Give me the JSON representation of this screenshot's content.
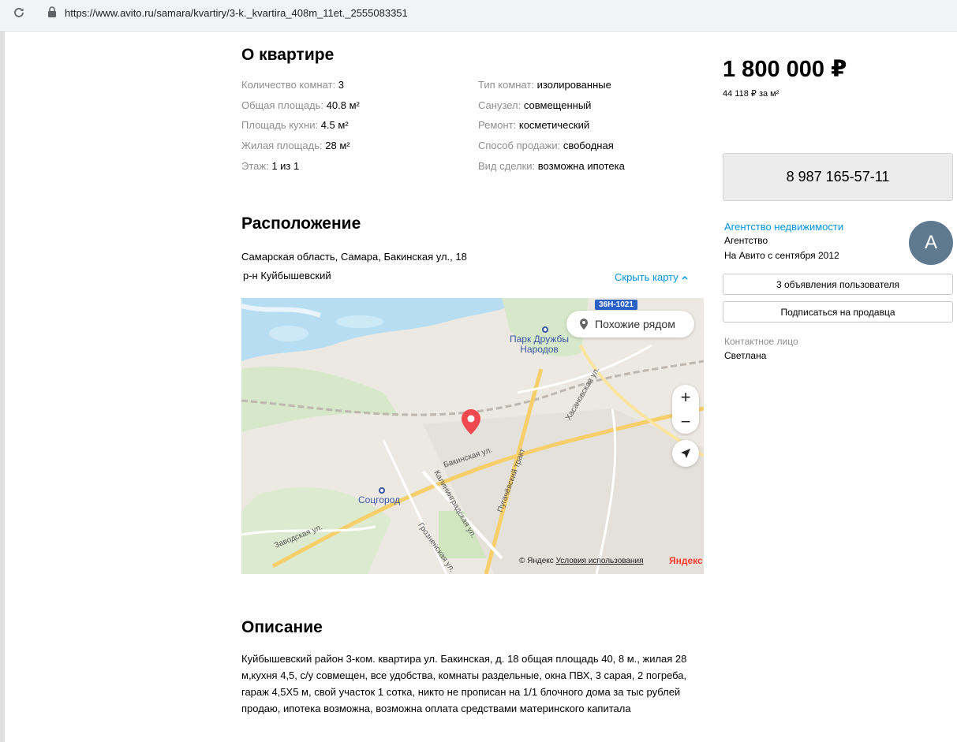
{
  "browser": {
    "url": "https://www.avito.ru/samara/kvartiry/3-k._kvartira_408m_11et._2555083351"
  },
  "about": {
    "title": "О квартире",
    "left": [
      {
        "key": "Количество комнат: ",
        "value": "3"
      },
      {
        "key": "Общая площадь: ",
        "value": "40.8 м²"
      },
      {
        "key": "Площадь кухни: ",
        "value": "4.5 м²"
      },
      {
        "key": "Жилая площадь: ",
        "value": "28 м²"
      },
      {
        "key": "Этаж: ",
        "value": "1 из 1"
      }
    ],
    "right": [
      {
        "key": "Тип комнат: ",
        "value": "изолированные"
      },
      {
        "key": "Санузел: ",
        "value": "совмещенный"
      },
      {
        "key": "Ремонт: ",
        "value": "косметический"
      },
      {
        "key": "Способ продажи: ",
        "value": "свободная"
      },
      {
        "key": "Вид сделки: ",
        "value": "возможна ипотека"
      }
    ]
  },
  "location": {
    "title": "Расположение",
    "address": "Самарская область, Самара, Бакинская ул., 18",
    "district": "р-н Куйбышевский",
    "hide_map": "Скрыть карту",
    "map": {
      "similar_button": "Похожие рядом",
      "zoom_in": "+",
      "zoom_out": "−",
      "road_shield": "36Н-1021",
      "labels": {
        "park": "Парк Дружбы Народов",
        "park_line1": "Парк Дружбы",
        "park_line2": "Народов",
        "socgorod": "Соцгород",
        "bakinskaya": "Бакинская ул.",
        "kaliningradskaya": "Калининградская ул.",
        "pugachevsky": "Пугачёвский тракт",
        "khasanovskaya": "Хасановская ул.",
        "zavodskaya": "Заводская ул.",
        "groznenskaya": "Грозненская ул."
      },
      "copyright": "© Яндекс",
      "terms": "Условия использования",
      "logo": "Яндекс"
    }
  },
  "description": {
    "title": "Описание",
    "text": "Куйбышевский район 3-ком. квартира ул. Бакинская, д. 18 общая площадь 40, 8 м., жилая 28 м,кухня 4,5, с/у совмещен, все удобства, комнаты раздельные, окна ПВХ, 3 сарая, 2 погреба, гараж 4,5Х5 м, свой участок 1 сотка, никто не прописан на 1/1 блочного дома за тыс рублей продаю, ипотека возможна, возможна оплата средствами материнского капитала"
  },
  "sidebar": {
    "price": "1 800 000 ₽",
    "price_per_m": "44 118 ₽ за м²",
    "phone": "8 987 165-57-11",
    "seller_name": "Агентство недвижимости",
    "seller_type": "Агентство",
    "seller_since": "На Авито с сентября 2012",
    "avatar_letter": "А",
    "listings_button": "3 объявления пользователя",
    "subscribe_button": "Подписаться на продавца",
    "contact_label": "Контактное лицо",
    "contact_name": "Светлана"
  },
  "colors": {
    "link": "#0094dd",
    "avatar": "#5f7a8e",
    "pin": "#f0484f"
  }
}
